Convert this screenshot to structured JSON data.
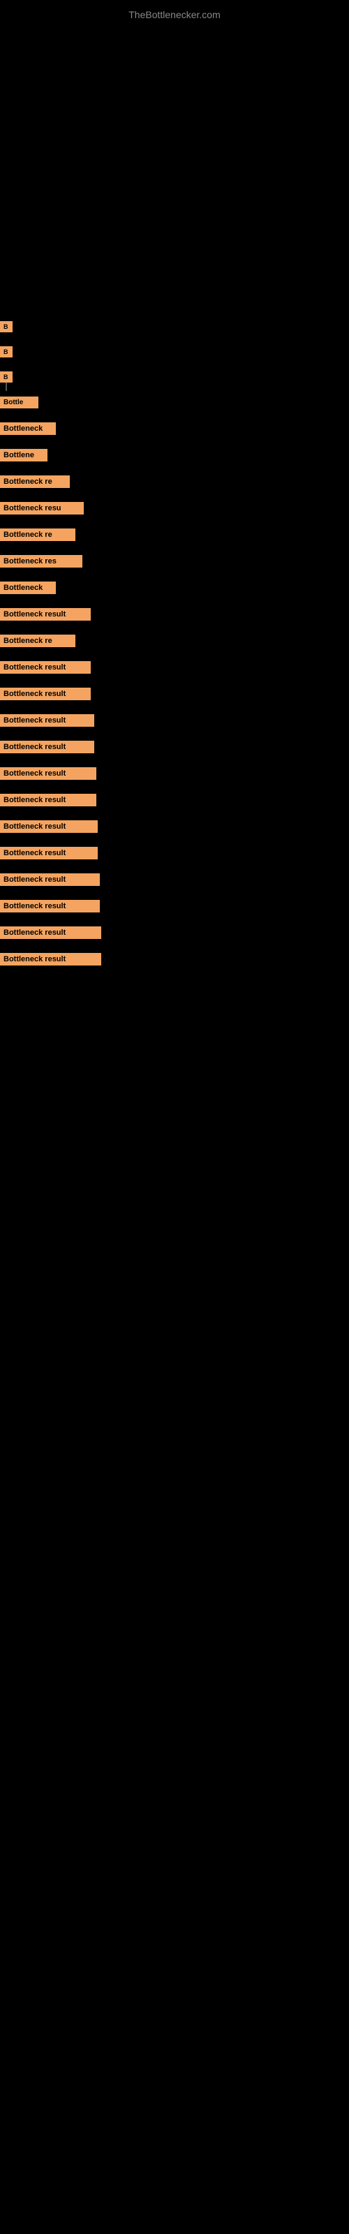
{
  "site": {
    "title": "TheBottlenecker.com"
  },
  "items": [
    {
      "id": 1,
      "label": "B",
      "rowClass": "row-1"
    },
    {
      "id": 2,
      "label": "B",
      "rowClass": "row-2"
    },
    {
      "id": 3,
      "label": "B",
      "rowClass": "row-3"
    },
    {
      "id": 4,
      "label": "Bottle",
      "rowClass": "row-4"
    },
    {
      "id": 5,
      "label": "Bottleneck",
      "rowClass": "row-5"
    },
    {
      "id": 6,
      "label": "Bottlene",
      "rowClass": "row-6"
    },
    {
      "id": 7,
      "label": "Bottleneck re",
      "rowClass": "row-7"
    },
    {
      "id": 8,
      "label": "Bottleneck resu",
      "rowClass": "row-8"
    },
    {
      "id": 9,
      "label": "Bottleneck re",
      "rowClass": "row-9"
    },
    {
      "id": 10,
      "label": "Bottleneck res",
      "rowClass": "row-10"
    },
    {
      "id": 11,
      "label": "Bottleneck",
      "rowClass": "row-11"
    },
    {
      "id": 12,
      "label": "Bottleneck result",
      "rowClass": "row-12"
    },
    {
      "id": 13,
      "label": "Bottleneck re",
      "rowClass": "row-13"
    },
    {
      "id": 14,
      "label": "Bottleneck result",
      "rowClass": "row-14"
    },
    {
      "id": 15,
      "label": "Bottleneck result",
      "rowClass": "row-15"
    },
    {
      "id": 16,
      "label": "Bottleneck result",
      "rowClass": "row-16"
    },
    {
      "id": 17,
      "label": "Bottleneck result",
      "rowClass": "row-17"
    },
    {
      "id": 18,
      "label": "Bottleneck result",
      "rowClass": "row-18"
    },
    {
      "id": 19,
      "label": "Bottleneck result",
      "rowClass": "row-19"
    },
    {
      "id": 20,
      "label": "Bottleneck result",
      "rowClass": "row-20"
    },
    {
      "id": 21,
      "label": "Bottleneck result",
      "rowClass": "row-21"
    },
    {
      "id": 22,
      "label": "Bottleneck result",
      "rowClass": "row-22"
    },
    {
      "id": 23,
      "label": "Bottleneck result",
      "rowClass": "row-23"
    },
    {
      "id": 24,
      "label": "Bottleneck result",
      "rowClass": "row-24"
    },
    {
      "id": 25,
      "label": "Bottleneck result",
      "rowClass": "row-25"
    }
  ]
}
